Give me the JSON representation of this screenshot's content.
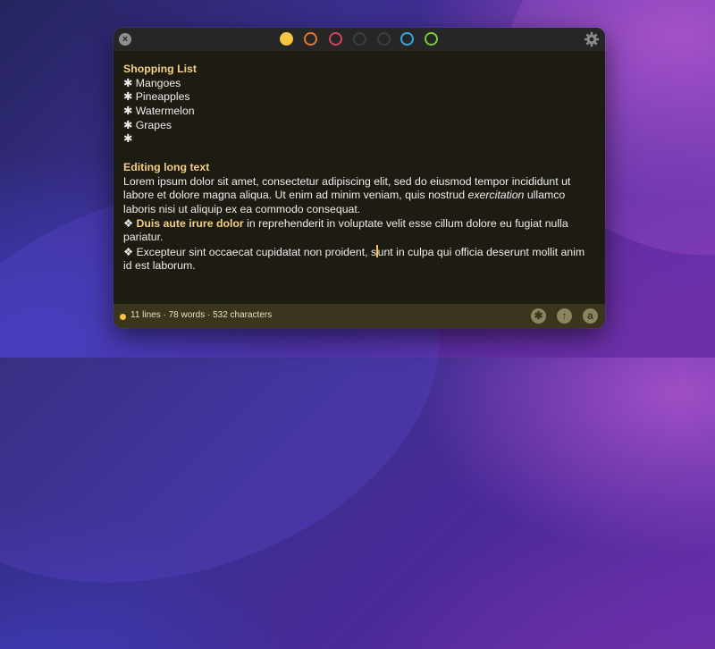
{
  "toolbar": {
    "close_glyph": "×",
    "color_dots": [
      {
        "name": "yellow",
        "color": "#f6c343",
        "active": true
      },
      {
        "name": "orange",
        "color": "#e07a2e",
        "active": false
      },
      {
        "name": "red",
        "color": "#d9405e",
        "active": false
      },
      {
        "name": "dark-gray",
        "color": "#3e3e3e",
        "active": false
      },
      {
        "name": "dark-gray-2",
        "color": "#3e3e3e",
        "active": false
      },
      {
        "name": "blue",
        "color": "#35a7e6",
        "active": false
      },
      {
        "name": "green",
        "color": "#7ac943",
        "active": false
      }
    ],
    "settings_icon": "gear-icon"
  },
  "note": {
    "shopping_heading": "Shopping List",
    "bullet_glyph": "✱",
    "shopping_items": [
      "Mangoes",
      "Pineapples",
      "Watermelon",
      "Grapes",
      ""
    ],
    "editing_heading": "Editing long text",
    "paragraph_lines": [
      "Lorem ipsum dolor sit amet, consectetur adipiscing elit, sed do eiusmod tempor incididunt ut",
      "labore et dolore magna aliqua. Ut enim ad minim veniam, quis nostrud",
      "laboris nisi ut aliquip ex ea commodo consequat."
    ],
    "italic_word": "exercitation",
    "line2_tail": " ullamco",
    "diamond_glyph": "❖",
    "bold_phrase": "Duis aute irure dolor",
    "line_bold_tail": " in reprehenderit in voluptate velit esse cillum dolore eu fugiat nulla",
    "line_pariatur": "pariatur.",
    "line_excepteur_before_cursor": "Excepteur sint occaecat cupidatat non proident, s",
    "line_excepteur_after_cursor": "unt in culpa qui officia deserunt mollit anim",
    "line_last": "id est laborum."
  },
  "status": {
    "text": "11 lines · 78 words · 532 characters",
    "buttons": [
      {
        "name": "bullet-button",
        "glyph": "✱"
      },
      {
        "name": "share-button",
        "glyph": "↑"
      },
      {
        "name": "font-button",
        "glyph": "a"
      }
    ],
    "accent": "#f6c343"
  }
}
